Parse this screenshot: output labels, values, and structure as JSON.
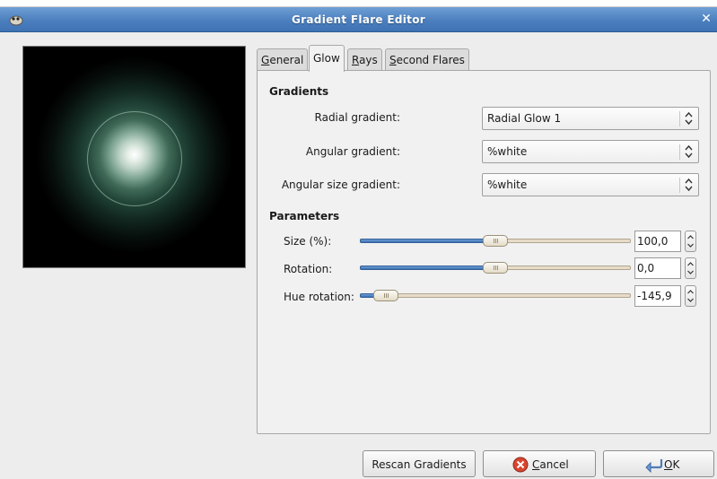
{
  "window": {
    "title": "Gradient Flare Editor"
  },
  "tabs": [
    {
      "mnemonic": "G",
      "rest": "eneral"
    },
    {
      "mnemonic": "",
      "rest": "Glow"
    },
    {
      "mnemonic": "R",
      "rest": "ays"
    },
    {
      "mnemonic": "S",
      "rest": "econd Flares"
    }
  ],
  "gradients": {
    "heading": "Gradients",
    "radial": {
      "label": "Radial gradient:",
      "value": "Radial Glow 1"
    },
    "angular": {
      "label": "Angular gradient:",
      "value": "%white"
    },
    "angular_size": {
      "label": "Angular size gradient:",
      "value": "%white"
    }
  },
  "parameters": {
    "heading": "Parameters",
    "size": {
      "label": "Size (%):",
      "value": "100,0",
      "level": 0.5
    },
    "rotation": {
      "label": "Rotation:",
      "value": "0,0",
      "level": 0.5
    },
    "hue": {
      "label": "Hue rotation:",
      "value": "-145,9",
      "level": 0.095
    }
  },
  "buttons": {
    "rescan": "Rescan Gradients",
    "cancel_mnemonic": "C",
    "cancel_rest": "ancel",
    "ok_mnemonic": "O",
    "ok_rest": "K"
  },
  "colors": {
    "titlebar": "#4b7fbe",
    "slider_fill": "#3b6fb0",
    "glow": "#7fa593"
  },
  "icons": {
    "window": "gimp-wilber-icon",
    "close": "close-icon",
    "cancel": "cancel-icon",
    "ok": "ok-icon"
  }
}
